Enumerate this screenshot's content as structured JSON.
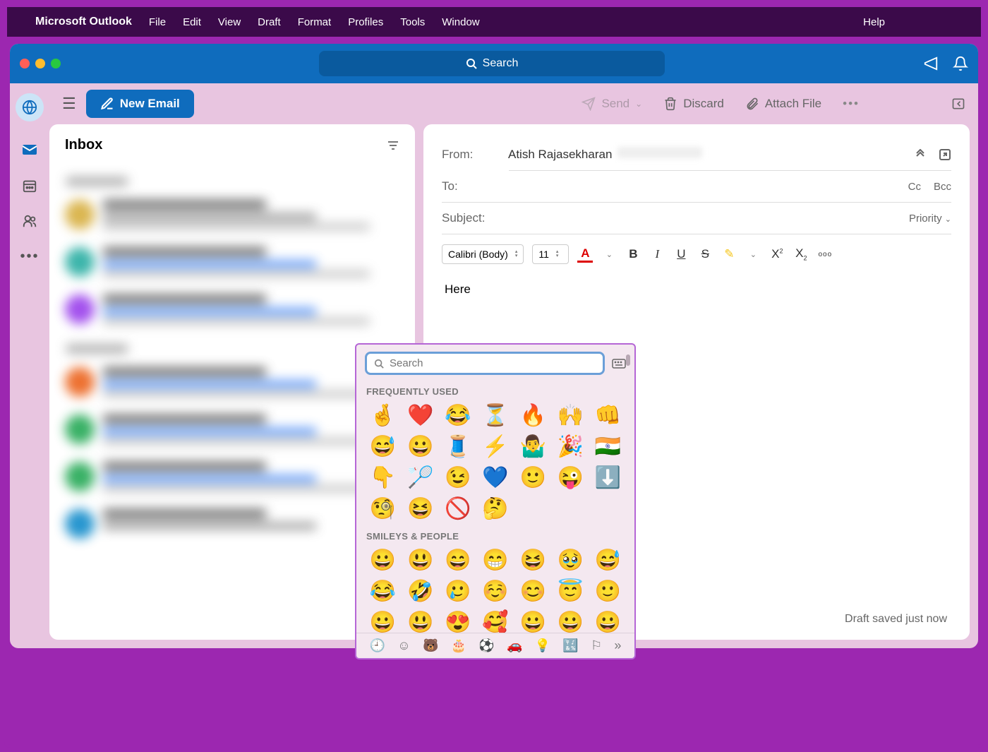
{
  "menubar": {
    "app": "Microsoft Outlook",
    "items": [
      "File",
      "Edit",
      "View",
      "Draft",
      "Format",
      "Profiles",
      "Tools",
      "Window"
    ],
    "help": "Help"
  },
  "titlebar": {
    "search_placeholder": "Search"
  },
  "toolbar": {
    "new_email": "New Email",
    "send": "Send",
    "discard": "Discard",
    "attach": "Attach File"
  },
  "inbox": {
    "title": "Inbox"
  },
  "compose": {
    "from_label": "From:",
    "from_name": "Atish Rajasekharan",
    "to_label": "To:",
    "cc": "Cc",
    "bcc": "Bcc",
    "subject_label": "Subject:",
    "priority": "Priority",
    "font_name": "Calibri (Body)",
    "font_size": "11",
    "body_text": "Here",
    "draft_status": "Draft saved just now"
  },
  "emoji": {
    "search_placeholder": "Search",
    "section_frequent": "FREQUENTLY USED",
    "section_smileys": "SMILEYS & PEOPLE",
    "frequent": [
      "🤞",
      "❤️",
      "😂",
      "⏳",
      "🔥",
      "🙌",
      "👊",
      "😅",
      "😀",
      "🧵",
      "⚡",
      "🤷‍♂️",
      "🎉",
      "🇮🇳",
      "👇",
      "🏸",
      "😉",
      "💙",
      "🙂",
      "😜",
      "⬇️",
      "🧐",
      "😆",
      "🚫",
      "🤔"
    ],
    "smileys": [
      "😀",
      "😃",
      "😄",
      "😁",
      "😆",
      "🥹",
      "😅",
      "😂",
      "🤣",
      "🥲",
      "☺️",
      "😊",
      "😇",
      "🙂",
      "😀",
      "😃",
      "😍",
      "🥰",
      "😀",
      "😀",
      "😀"
    ]
  }
}
